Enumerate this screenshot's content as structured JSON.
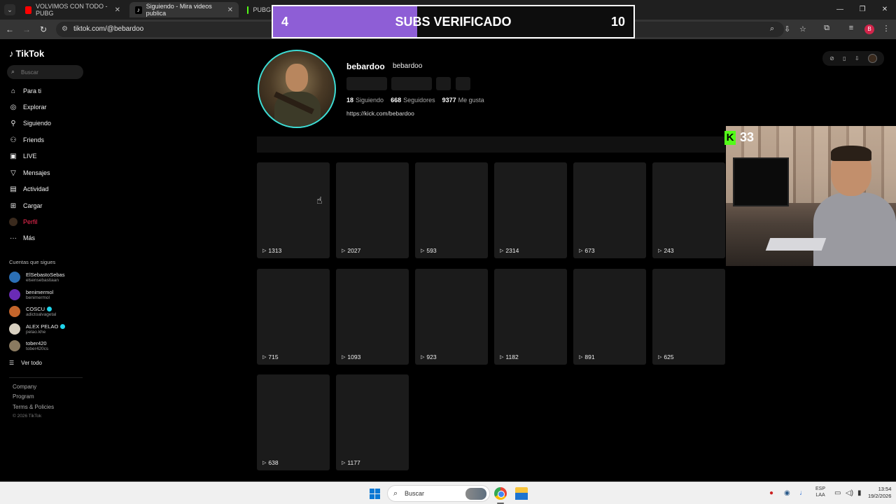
{
  "browser": {
    "tabs": [
      {
        "title": "VOLVIMOS CON TODO - PUBG",
        "icon": "youtube-icon",
        "color": "#ff0000"
      },
      {
        "title": "Siguiendo - Mira videos publica",
        "icon": "tiktok-icon",
        "color": "#ffffff"
      },
      {
        "title": "PUBG",
        "icon": "kick-icon",
        "color": "#53fc18"
      }
    ],
    "url": "tiktok.com/@bebardoo",
    "profile_initial": "B"
  },
  "sidebar": {
    "logo": "TikTok",
    "search_placeholder": "Buscar",
    "nav": [
      {
        "label": "Para ti",
        "icon": "home-icon"
      },
      {
        "label": "Explorar",
        "icon": "compass-icon"
      },
      {
        "label": "Siguiendo",
        "icon": "user-follow-icon"
      },
      {
        "label": "Friends",
        "icon": "friends-icon"
      },
      {
        "label": "LIVE",
        "icon": "live-icon"
      },
      {
        "label": "Mensajes",
        "icon": "messages-icon"
      },
      {
        "label": "Actividad",
        "icon": "activity-icon"
      },
      {
        "label": "Cargar",
        "icon": "upload-icon"
      },
      {
        "label": "Perfil",
        "icon": "profile-avatar-icon"
      },
      {
        "label": "Más",
        "icon": "more-icon"
      }
    ],
    "following_heading": "Cuentas que sigues",
    "accounts": [
      {
        "name": "ElSebastoSebas",
        "handle": "elsensebastiaan",
        "verified": false,
        "color": "#2b6fb5"
      },
      {
        "name": "benimermol",
        "handle": "benimermol",
        "verified": false,
        "color": "#6a2bb5"
      },
      {
        "name": "COSCU",
        "handle": "adictoalvagetal",
        "verified": true,
        "color": "#c4652b"
      },
      {
        "name": "ALEX PELAO",
        "handle": "pelao.khe",
        "verified": true,
        "color": "#d8d0c0"
      },
      {
        "name": "tober420",
        "handle": "tober420cs",
        "verified": false,
        "color": "#8a7a60"
      }
    ],
    "see_all": "Ver todo",
    "footer": [
      "Company",
      "Program",
      "Terms & Policies"
    ],
    "copyright": "© 2026 TikTok"
  },
  "profile": {
    "username": "bebardoo",
    "nickname": "bebardoo",
    "following_count": "18",
    "following_label": "Siguiendo",
    "followers_count": "668",
    "followers_label": "Seguidores",
    "likes_count": "9377",
    "likes_label": "Me gusta",
    "bio_link": "https://kick.com/bebardoo"
  },
  "videos": [
    "1313",
    "2027",
    "593",
    "2314",
    "673",
    "243",
    "715",
    "1093",
    "923",
    "1182",
    "891",
    "625",
    "638",
    "1177"
  ],
  "overlay": {
    "subs_current": "4",
    "subs_title": "SUBS VERIFICADO",
    "subs_goal": "10",
    "subs_progress": 0.4,
    "kick_viewers": "33"
  },
  "taskbar": {
    "search_placeholder": "Buscar",
    "lang_line1": "ESP",
    "lang_line2": "LAA",
    "time": "13:54",
    "date": "19/2/2026"
  }
}
